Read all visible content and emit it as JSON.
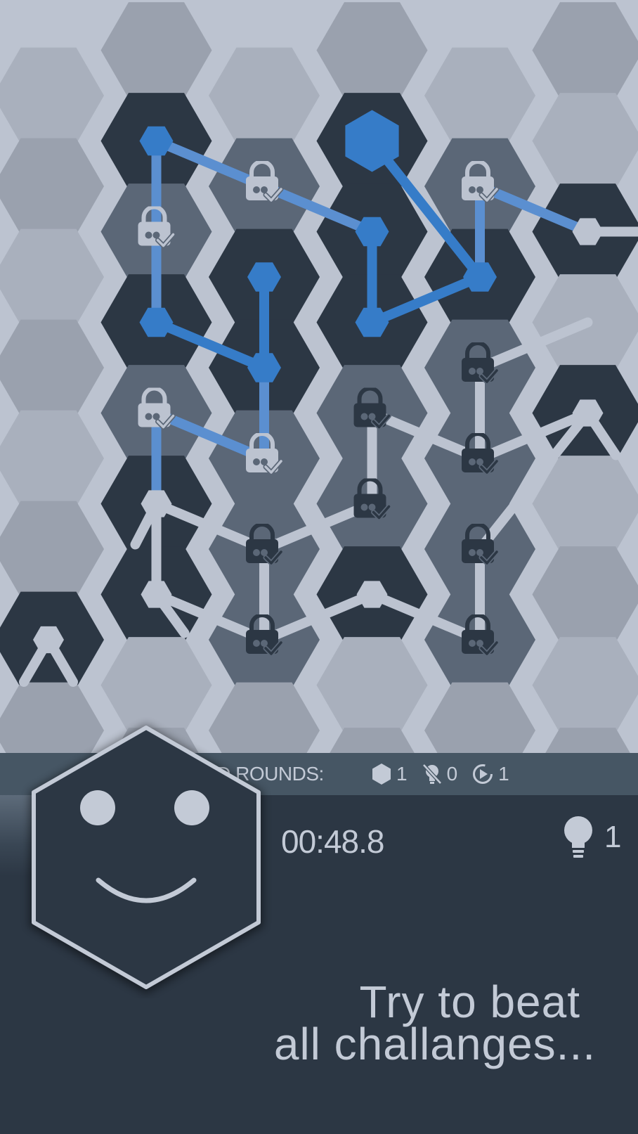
{
  "colors": {
    "background_light": "#bcc3d0",
    "background_dark": "#2c3744",
    "tile_dark": "#2c3744",
    "tile_locked": "#5b6777",
    "tile_empty_a": "#a9b0bd",
    "tile_empty_b": "#9aa1ae",
    "accent_blue": "#367cc8",
    "connector_light": "#bcc3d0",
    "strip": "#465664",
    "text": "#c3cad6"
  },
  "status_strip": {
    "label": "ED ROUNDS:",
    "solved_icon": "hexagon-icon",
    "solved_count": "1",
    "no_hint_icon": "no-hint-bulb-icon",
    "no_hint_count": "0",
    "replay_icon": "replay-icon",
    "replay_count": "1"
  },
  "timer": "00:48.8",
  "hints": {
    "icon": "lightbulb-icon",
    "count": "1"
  },
  "avatar": {
    "icon": "smiley-hexagon-icon"
  },
  "message": {
    "line1": "Try to beat",
    "line2": "all challanges..."
  },
  "board": {
    "tile_icons": {
      "locked": "lock-check-icon"
    },
    "tiles": [
      {
        "col": 1,
        "row": 1,
        "type": "dark"
      },
      {
        "col": 2,
        "row": 1,
        "type": "locked",
        "variant": "light"
      },
      {
        "col": 3,
        "row": 1,
        "type": "dark",
        "filled": true
      },
      {
        "col": 4,
        "row": 1,
        "type": "locked",
        "variant": "light"
      },
      {
        "col": 1,
        "row": 2,
        "type": "locked",
        "variant": "light"
      },
      {
        "col": 2,
        "row": 2,
        "type": "dark"
      },
      {
        "col": 3,
        "row": 2,
        "type": "dark"
      },
      {
        "col": 4,
        "row": 2,
        "type": "dark"
      },
      {
        "col": 5,
        "row": 2,
        "type": "dark"
      },
      {
        "col": 1,
        "row": 3,
        "type": "dark"
      },
      {
        "col": 2,
        "row": 3,
        "type": "dark"
      },
      {
        "col": 3,
        "row": 3,
        "type": "dark"
      },
      {
        "col": 4,
        "row": 3,
        "type": "locked",
        "variant": "dark"
      },
      {
        "col": 1,
        "row": 4,
        "type": "locked",
        "variant": "light"
      },
      {
        "col": 2,
        "row": 4,
        "type": "locked",
        "variant": "light"
      },
      {
        "col": 3,
        "row": 4,
        "type": "locked",
        "variant": "dark"
      },
      {
        "col": 4,
        "row": 4,
        "type": "locked",
        "variant": "dark"
      },
      {
        "col": 5,
        "row": 4,
        "type": "dark"
      },
      {
        "col": 1,
        "row": 5,
        "type": "dark"
      },
      {
        "col": 2,
        "row": 5,
        "type": "locked",
        "variant": "dark"
      },
      {
        "col": 3,
        "row": 5,
        "type": "locked",
        "variant": "dark"
      },
      {
        "col": 4,
        "row": 5,
        "type": "locked",
        "variant": "dark"
      },
      {
        "col": 0,
        "row": 6,
        "type": "dark"
      },
      {
        "col": 1,
        "row": 6,
        "type": "dark"
      },
      {
        "col": 2,
        "row": 6,
        "type": "locked",
        "variant": "dark"
      },
      {
        "col": 3,
        "row": 6,
        "type": "dark"
      },
      {
        "col": 4,
        "row": 6,
        "type": "locked",
        "variant": "dark"
      }
    ]
  }
}
